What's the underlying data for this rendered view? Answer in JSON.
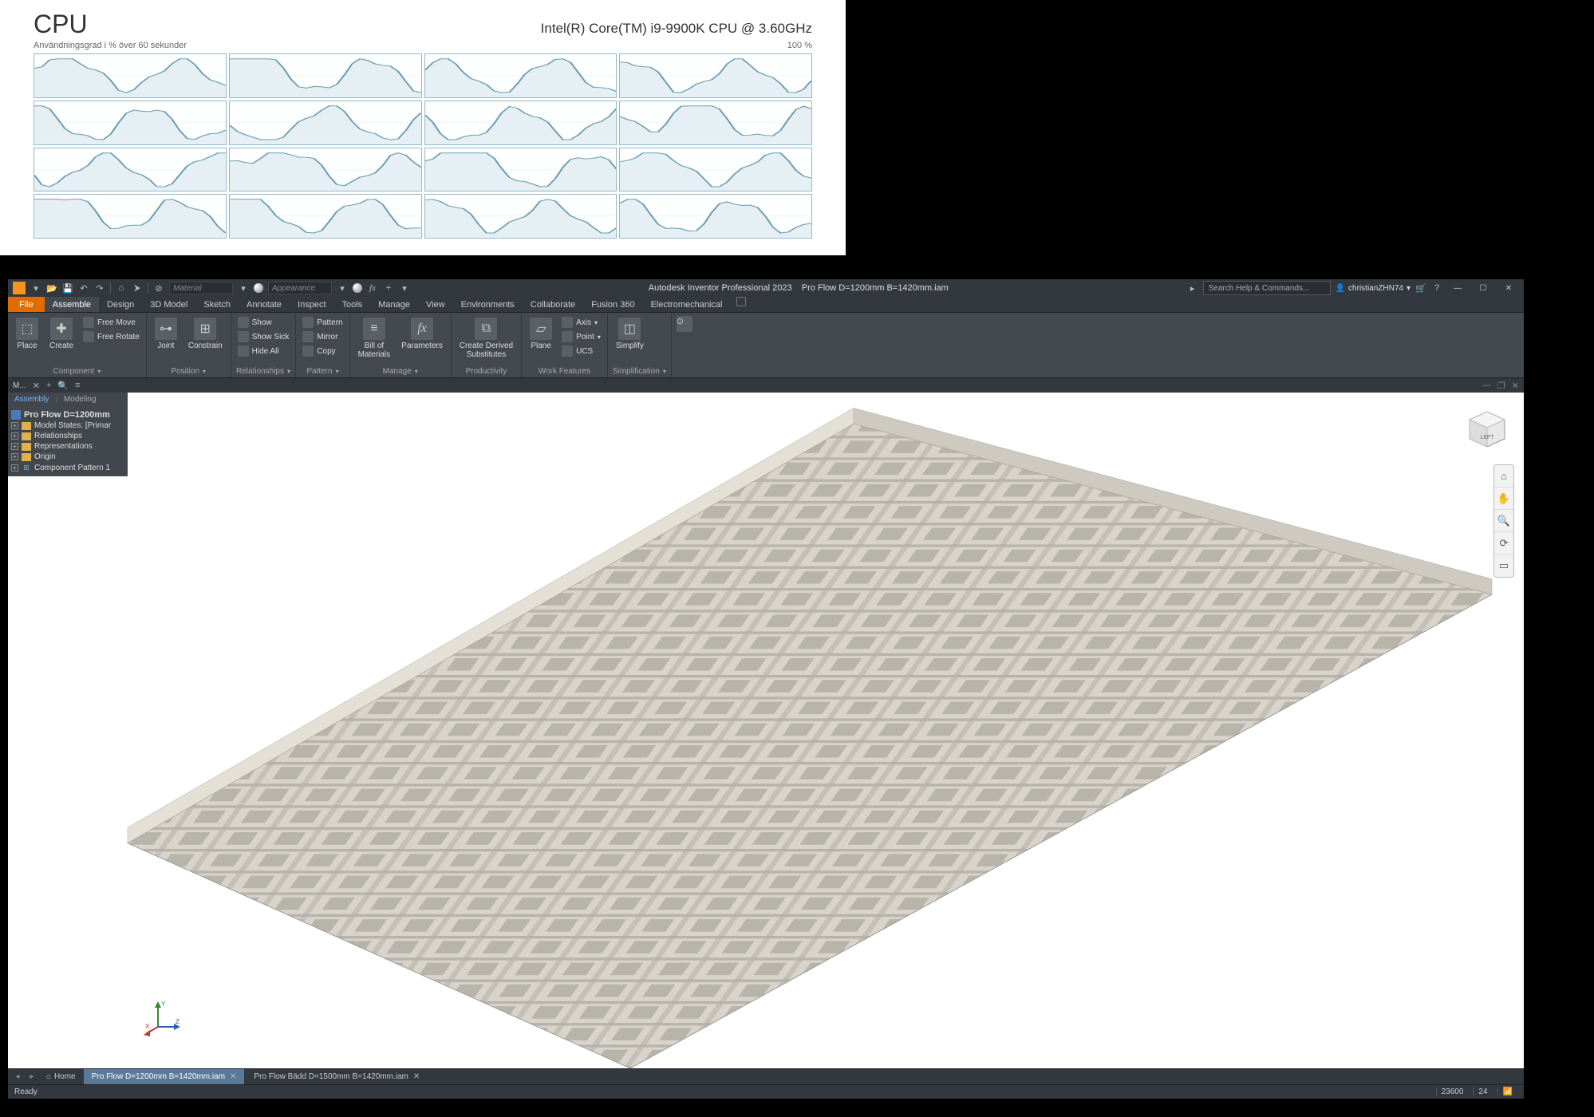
{
  "cpu": {
    "title": "CPU",
    "model": "Intel(R) Core(TM) i9-9900K CPU @ 3.60GHz",
    "sub_left": "Användningsgrad i % över 60 sekunder",
    "sub_right": "100 %"
  },
  "titlebar": {
    "product": "Autodesk Inventor Professional 2023",
    "document": "Pro Flow D=1200mm B=1420mm.iam",
    "material_placeholder": "Material",
    "appearance_placeholder": "Appearance",
    "search_placeholder": "Search Help & Commands...",
    "user": "christianZHN74"
  },
  "ribbon_tabs": {
    "file": "File",
    "items": [
      "Assemble",
      "Design",
      "3D Model",
      "Sketch",
      "Annotate",
      "Inspect",
      "Tools",
      "Manage",
      "View",
      "Environments",
      "Collaborate",
      "Fusion 360",
      "Electromechanical"
    ],
    "active_index": 0
  },
  "ribbon": {
    "component": {
      "label": "Component",
      "place": "Place",
      "create": "Create",
      "free_move": "Free Move",
      "free_rotate": "Free Rotate"
    },
    "position": {
      "label": "Position",
      "joint": "Joint",
      "constrain": "Constrain"
    },
    "relationships": {
      "label": "Relationships",
      "show": "Show",
      "show_sick": "Show Sick",
      "hide_all": "Hide All"
    },
    "pattern": {
      "label": "Pattern",
      "pattern": "Pattern",
      "mirror": "Mirror",
      "copy": "Copy"
    },
    "manage": {
      "label": "Manage",
      "bom": "Bill of\nMaterials",
      "params": "Parameters"
    },
    "productivity": {
      "label": "Productivity",
      "derived": "Create Derived\nSubstitutes"
    },
    "work": {
      "label": "Work Features",
      "plane": "Plane",
      "axis": "Axis",
      "point": "Point",
      "ucs": "UCS"
    },
    "simplify": {
      "label": "Simplification",
      "simplify": "Simplify"
    }
  },
  "browser": {
    "tab_assembly": "Assembly",
    "tab_modeling": "Modeling",
    "root": "Pro Flow D=1200mm",
    "items": [
      "Model States: [Primar",
      "Relationships",
      "Representations",
      "Origin",
      "Component Pattern 1"
    ],
    "header_label": "M..."
  },
  "doctabs": {
    "home": "Home",
    "tabs": [
      {
        "label": "Pro Flow D=1200mm B=1420mm.iam",
        "active": true
      },
      {
        "label": "Pro Flow Bädd  D=1500mm B=1420mm.iam",
        "active": false
      }
    ]
  },
  "status": {
    "ready": "Ready",
    "num1": "23600",
    "num2": "24"
  },
  "viewcube": {
    "face": "LEFT"
  }
}
